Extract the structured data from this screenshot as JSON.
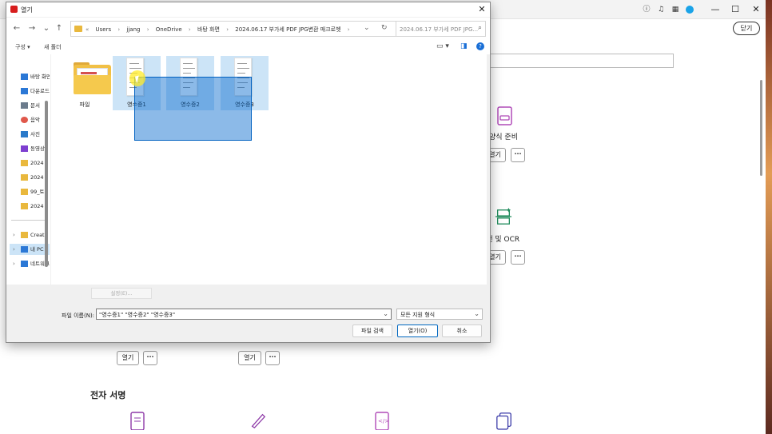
{
  "background_app": {
    "close_label": "닫기",
    "tools": [
      {
        "label": "양식 준비",
        "open_label": "열기",
        "more_label": "···"
      },
      {
        "label": "스캔 및 OCR",
        "open_label": "열기",
        "more_label": "···"
      },
      {
        "label": "",
        "open_label": "열기",
        "more_label": "···"
      },
      {
        "label": "",
        "open_label": "열기",
        "more_label": "···"
      }
    ],
    "section_title": "전자 서명",
    "window_buttons": {
      "minimize": "—",
      "maximize": "☐",
      "close": "✕"
    }
  },
  "dialog": {
    "title": "열기",
    "close_glyph": "✕",
    "nav": {
      "back": "←",
      "forward": "→",
      "recent": "⌄",
      "up": "↑"
    },
    "breadcrumbs": [
      "«",
      "Users",
      "›",
      "jjang",
      "›",
      "OneDrive",
      "›",
      "바탕 화면",
      "›",
      "2024.06.17 부가세 PDF JPG변환 매크로벳",
      "›"
    ],
    "search_placeholder": "2024.06.17 부가세 PDF JPG...",
    "toolbar": {
      "organize": "구성 ▾",
      "new_folder": "새 폴더",
      "help": "?"
    },
    "nav_items": [
      {
        "label": "바탕 화면",
        "color": "#2b78d6"
      },
      {
        "label": "다운로드",
        "color": "#2b78d6"
      },
      {
        "label": "문서",
        "color": "#6b7b8c"
      },
      {
        "label": "음악",
        "color": "#e0584b"
      },
      {
        "label": "사진",
        "color": "#2a79c9"
      },
      {
        "label": "동영상",
        "color": "#7e3fd0"
      },
      {
        "label": "2024",
        "color": "#e9b83d"
      },
      {
        "label": "2024",
        "color": "#e9b83d"
      },
      {
        "label": "99_토",
        "color": "#e9b83d"
      },
      {
        "label": "2024",
        "color": "#e9b83d"
      }
    ],
    "nav_tree": [
      {
        "label": "Creat",
        "chev": "›",
        "color": "#e9b83d"
      },
      {
        "label": "내 PC",
        "chev": "›",
        "color": "#2b78d6"
      },
      {
        "label": "네트워크",
        "chev": "›",
        "color": "#2b78d6"
      }
    ],
    "files": [
      {
        "name": "파일",
        "kind": "folder",
        "selected": false
      },
      {
        "name": "영수증1",
        "kind": "image",
        "selected": true
      },
      {
        "name": "영수증2",
        "kind": "image",
        "selected": true
      },
      {
        "name": "영수증3",
        "kind": "image",
        "selected": true
      }
    ],
    "settings_label": "설정(E)...",
    "filename_label": "파일 이름(N):",
    "filename_value": "\"영수증1\" \"영수증2\" \"영수증3\"",
    "filetype_value": "모든 지원 형식",
    "buttons": {
      "find": "파일 검색",
      "open": "열기(O)",
      "cancel": "취소"
    }
  }
}
